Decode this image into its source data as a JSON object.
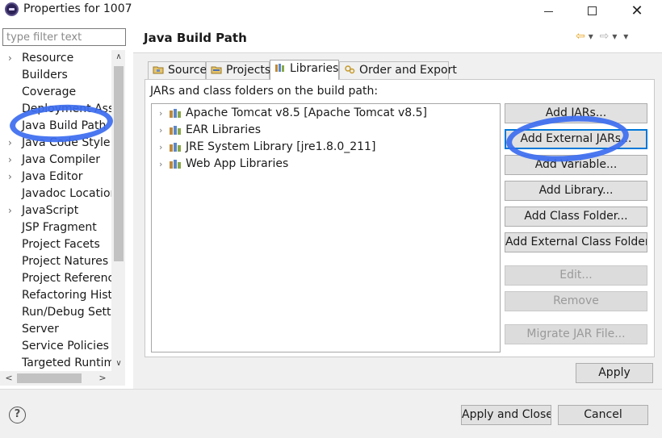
{
  "window": {
    "title": "Properties for 1007",
    "close_glyph": "✕"
  },
  "filter": {
    "placeholder": "type filter text"
  },
  "tree": {
    "items": [
      {
        "label": "Resource",
        "expandable": true
      },
      {
        "label": "Builders",
        "expandable": false
      },
      {
        "label": "Coverage",
        "expandable": false
      },
      {
        "label": "Deployment Assembly",
        "expandable": false
      },
      {
        "label": "Java Build Path",
        "expandable": false,
        "selected": true
      },
      {
        "label": "Java Code Style",
        "expandable": true
      },
      {
        "label": "Java Compiler",
        "expandable": true
      },
      {
        "label": "Java Editor",
        "expandable": true
      },
      {
        "label": "Javadoc Location",
        "expandable": false
      },
      {
        "label": "JavaScript",
        "expandable": true
      },
      {
        "label": "JSP Fragment",
        "expandable": false
      },
      {
        "label": "Project Facets",
        "expandable": false
      },
      {
        "label": "Project Natures",
        "expandable": false
      },
      {
        "label": "Project References",
        "expandable": false
      },
      {
        "label": "Refactoring History",
        "expandable": false
      },
      {
        "label": "Run/Debug Settings",
        "expandable": false
      },
      {
        "label": "Server",
        "expandable": false
      },
      {
        "label": "Service Policies",
        "expandable": false
      },
      {
        "label": "Targeted Runtimes",
        "expandable": false
      }
    ]
  },
  "page": {
    "title": "Java Build Path",
    "tabs": [
      {
        "label": "Source"
      },
      {
        "label": "Projects"
      },
      {
        "label": "Libraries",
        "active": true
      },
      {
        "label": "Order and Export"
      }
    ],
    "section_label": "JARs and class folders on the build path:",
    "libraries": [
      {
        "label": "Apache Tomcat v8.5 [Apache Tomcat v8.5]"
      },
      {
        "label": "EAR Libraries"
      },
      {
        "label": "JRE System Library [jre1.8.0_211]"
      },
      {
        "label": "Web App Libraries"
      }
    ],
    "buttons": {
      "add_jars": "Add JARs...",
      "add_external_jars": "Add External JARs...",
      "add_variable": "Add Variable...",
      "add_library": "Add Library...",
      "add_class_folder": "Add Class Folder...",
      "add_external_class_folder": "Add External Class Folder...",
      "edit": "Edit...",
      "remove": "Remove",
      "migrate_jar": "Migrate JAR File...",
      "apply": "Apply"
    }
  },
  "footer": {
    "apply_and_close": "Apply and Close",
    "cancel": "Cancel",
    "help_glyph": "?"
  },
  "colors": {
    "accent": "#0078d7",
    "annotation": "#3c6df0"
  }
}
